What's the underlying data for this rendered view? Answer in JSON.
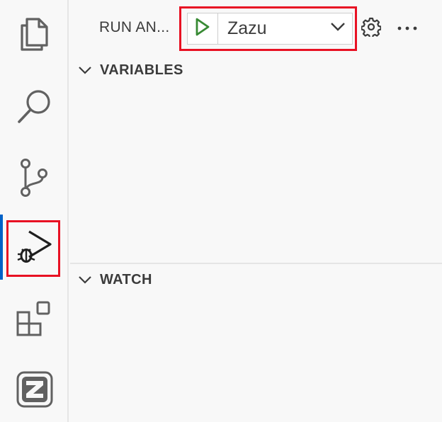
{
  "activity_bar": {
    "items": [
      {
        "name": "explorer",
        "icon": "files-icon"
      },
      {
        "name": "search",
        "icon": "search-icon"
      },
      {
        "name": "source-control",
        "icon": "source-control-icon"
      },
      {
        "name": "run-and-debug",
        "icon": "run-debug-icon",
        "active": true
      },
      {
        "name": "extensions",
        "icon": "extensions-icon"
      },
      {
        "name": "zazu",
        "icon": "zazu-logo-icon"
      }
    ],
    "accent_color": "#0062c8"
  },
  "sidebar": {
    "title": "RUN AN...",
    "launch_config": {
      "selected": "Zazu",
      "play_color": "#388a34"
    },
    "sections": [
      {
        "label": "VARIABLES",
        "expanded": true
      },
      {
        "label": "WATCH",
        "expanded": true
      }
    ]
  },
  "colors": {
    "highlight": "#e81123",
    "text": "#3b3b3b",
    "background": "#f8f8f8"
  }
}
